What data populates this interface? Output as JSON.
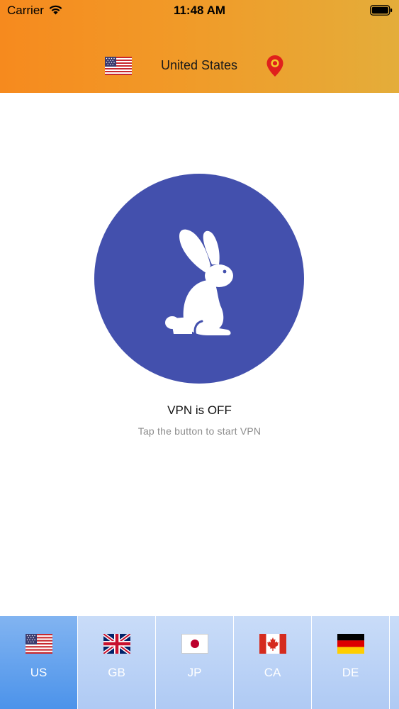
{
  "status_bar": {
    "carrier": "Carrier",
    "time": "11:48 AM"
  },
  "header": {
    "country": "United States",
    "flag_icon": "us-flag-icon",
    "location_icon": "map-pin-icon"
  },
  "connect": {
    "icon": "rabbit-icon",
    "status": "VPN is OFF",
    "hint": "Tap the button to start VPN"
  },
  "countries": [
    {
      "code": "US",
      "flag": "us-flag-icon",
      "selected": true
    },
    {
      "code": "GB",
      "flag": "gb-flag-icon",
      "selected": false
    },
    {
      "code": "JP",
      "flag": "jp-flag-icon",
      "selected": false
    },
    {
      "code": "CA",
      "flag": "ca-flag-icon",
      "selected": false
    },
    {
      "code": "DE",
      "flag": "de-flag-icon",
      "selected": false
    }
  ],
  "colors": {
    "header_start": "#f68a1e",
    "header_end": "#e4ad3a",
    "button": "#4350ad",
    "tab_active": "#4c93ea",
    "tab_inactive": "#b3cdf4",
    "pin": "#e0201c"
  }
}
